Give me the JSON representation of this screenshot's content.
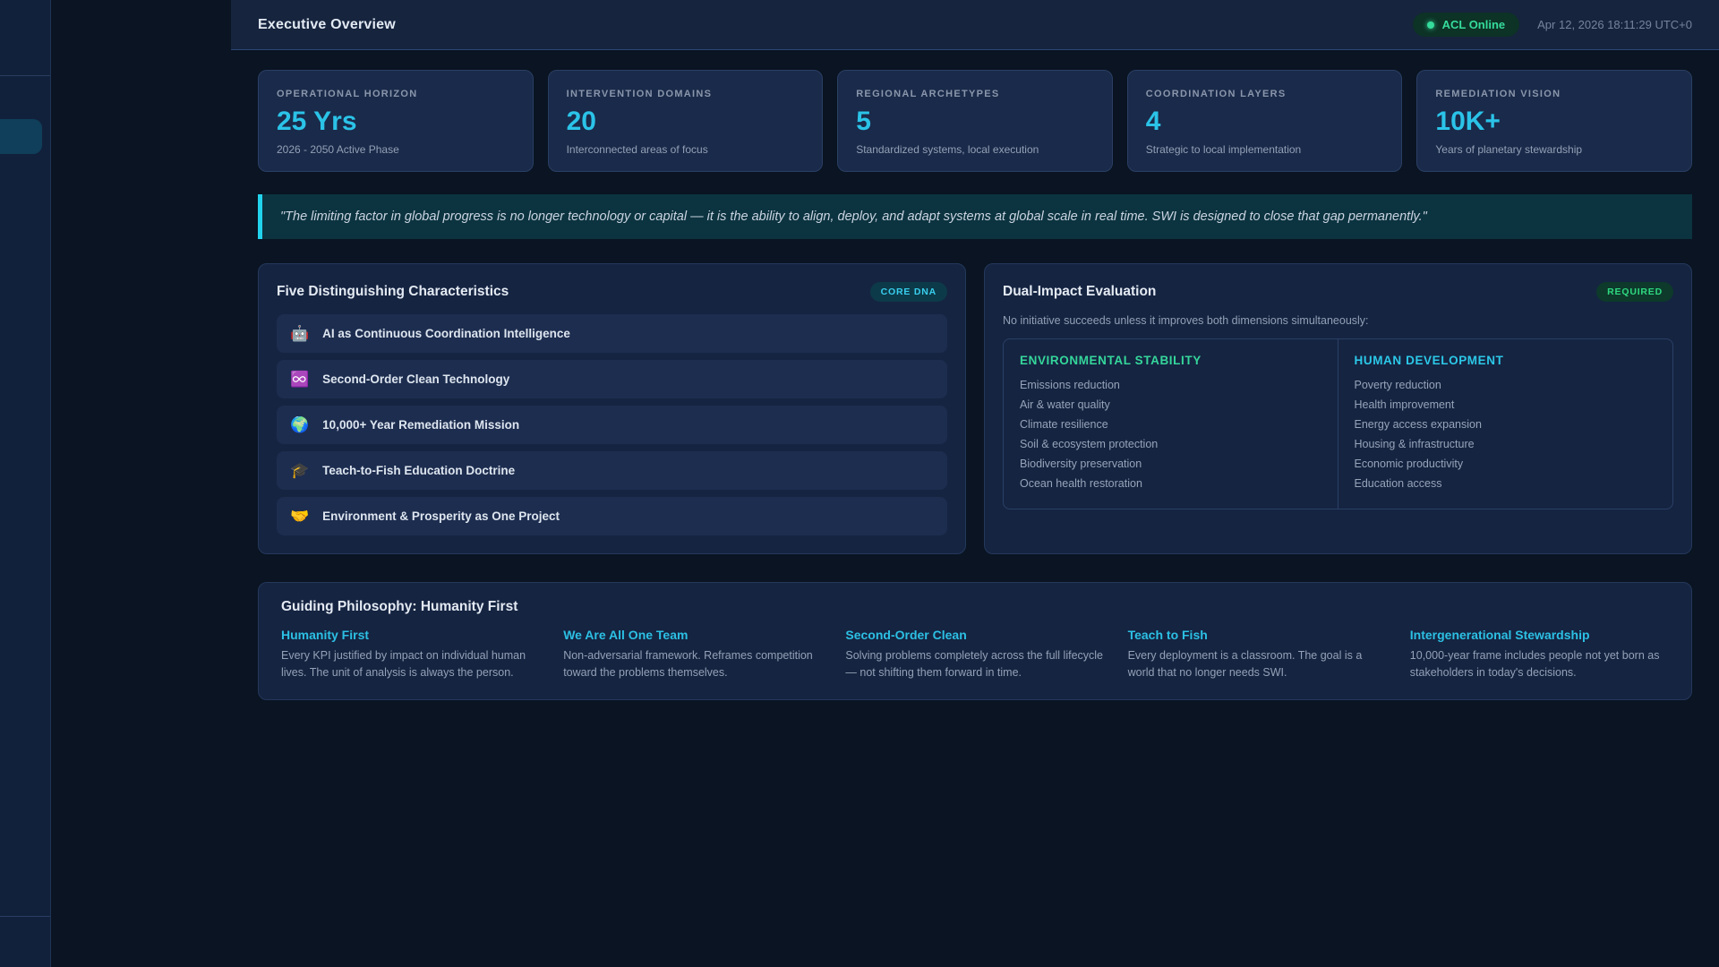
{
  "header": {
    "title": "Executive Overview",
    "status_badge": "ACL Online",
    "timestamp": "Apr 12, 2026 18:11:29 UTC+0"
  },
  "stats": [
    {
      "label": "OPERATIONAL HORIZON",
      "value": "25 Yrs",
      "subtitle": "2026 - 2050 Active Phase"
    },
    {
      "label": "INTERVENTION DOMAINS",
      "value": "20",
      "subtitle": "Interconnected areas of focus"
    },
    {
      "label": "REGIONAL ARCHETYPES",
      "value": "5",
      "subtitle": "Standardized systems, local execution"
    },
    {
      "label": "COORDINATION LAYERS",
      "value": "4",
      "subtitle": "Strategic to local implementation"
    },
    {
      "label": "REMEDIATION VISION",
      "value": "10K+",
      "subtitle": "Years of planetary stewardship"
    }
  ],
  "quote": "\"The limiting factor in global progress is no longer technology or capital — it is the ability to align, deploy, and adapt systems at global scale in real time. SWI is designed to close that gap permanently.\"",
  "characteristics": {
    "title": "Five Distinguishing Characteristics",
    "badge": "CORE DNA",
    "items": [
      {
        "icon": "🤖",
        "label": "AI as Continuous Coordination Intelligence"
      },
      {
        "icon": "♾️",
        "label": "Second-Order Clean Technology"
      },
      {
        "icon": "🌍",
        "label": "10,000+ Year Remediation Mission"
      },
      {
        "icon": "🎓",
        "label": "Teach-to-Fish Education Doctrine"
      },
      {
        "icon": "🤝",
        "label": "Environment & Prosperity as One Project"
      }
    ]
  },
  "dual_impact": {
    "title": "Dual-Impact Evaluation",
    "badge": "REQUIRED",
    "subtitle": "No initiative succeeds unless it improves both dimensions simultaneously:",
    "columns": [
      {
        "heading": "ENVIRONMENTAL STABILITY",
        "accent": "#35d69b",
        "items": [
          "Emissions reduction",
          "Air & water quality",
          "Climate resilience",
          "Soil & ecosystem protection",
          "Biodiversity preservation",
          "Ocean health restoration"
        ]
      },
      {
        "heading": "HUMAN DEVELOPMENT",
        "accent": "#2cc8e8",
        "items": [
          "Poverty reduction",
          "Health improvement",
          "Energy access expansion",
          "Housing & infrastructure",
          "Economic productivity",
          "Education access"
        ]
      }
    ]
  },
  "philosophy": {
    "title": "Guiding Philosophy: Humanity First",
    "columns": [
      {
        "heading": "Humanity First",
        "body": "Every KPI justified by impact on individual human lives. The unit of analysis is always the person."
      },
      {
        "heading": "We Are All One Team",
        "body": "Non-adversarial framework. Reframes competition toward the problems themselves."
      },
      {
        "heading": "Second-Order Clean",
        "body": "Solving problems completely across the full lifecycle — not shifting them forward in time."
      },
      {
        "heading": "Teach to Fish",
        "body": "Every deployment is a classroom. The goal is a world that no longer needs SWI."
      },
      {
        "heading": "Intergenerational Stewardship",
        "body": "10,000-year frame includes people not yet born as stakeholders in today's decisions."
      }
    ]
  },
  "appearance": {
    "accent_cyan": "#2bc3e8",
    "accent_green": "#35dc9b",
    "quote_border": "#22d3ee",
    "page_bg": "#0a1422",
    "panel_bg": "#152441"
  }
}
